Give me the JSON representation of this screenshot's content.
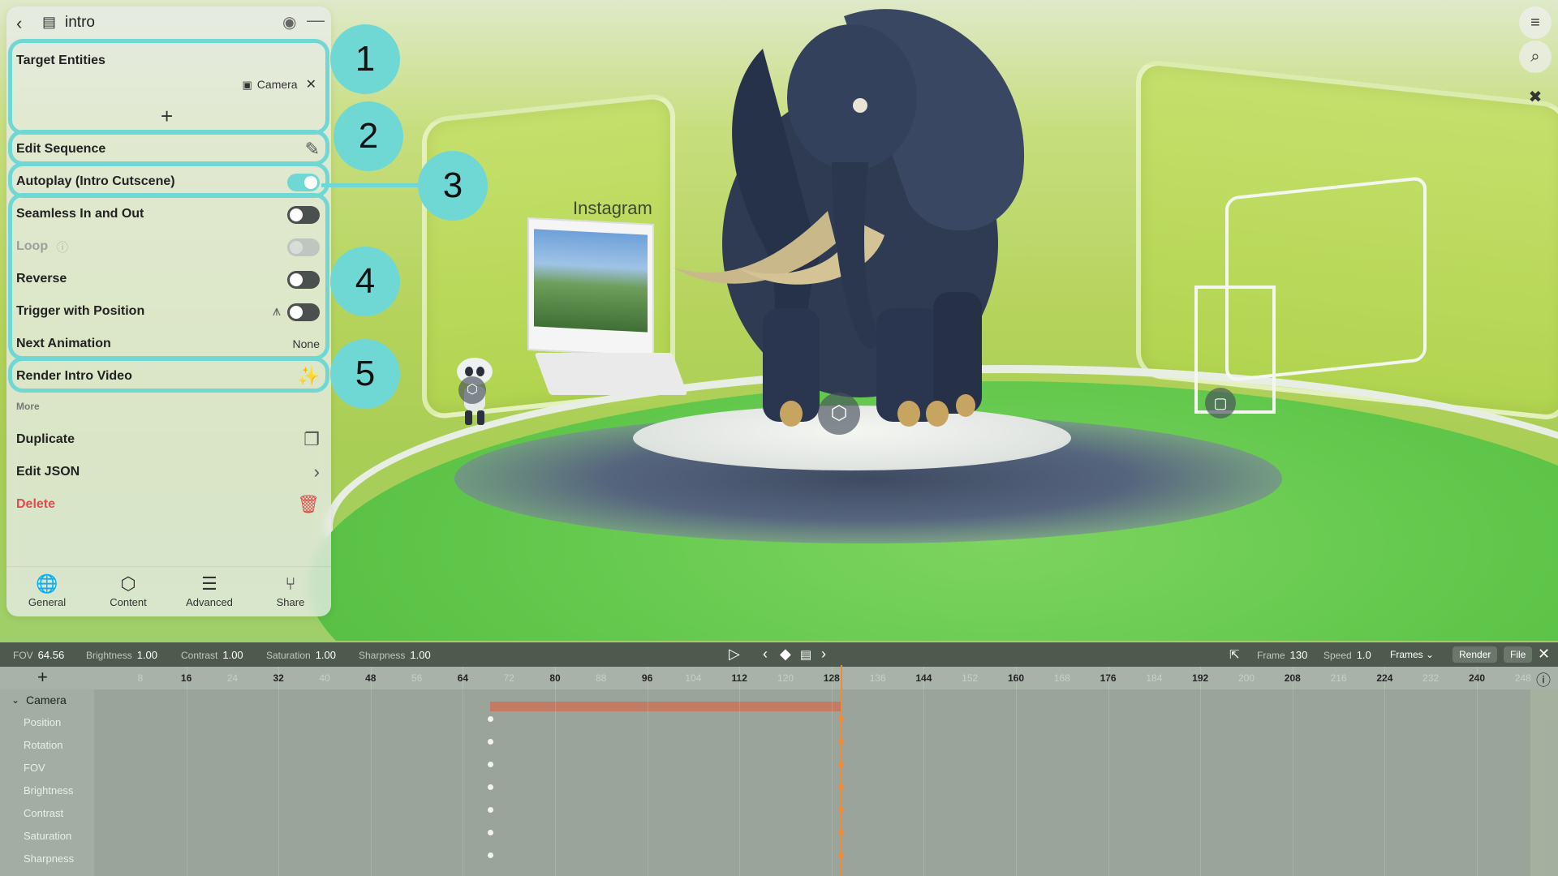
{
  "panel": {
    "title": "intro",
    "target_entities_label": "Target Entities",
    "target_chip_label": "Camera",
    "edit_sequence_label": "Edit Sequence",
    "autoplay_label": "Autoplay (Intro Cutscene)",
    "seamless_label": "Seamless In and Out",
    "loop_label": "Loop",
    "reverse_label": "Reverse",
    "trigger_label": "Trigger with Position",
    "next_animation_label": "Next Animation",
    "next_animation_value": "None",
    "render_video_label": "Render Intro Video",
    "more_label": "More",
    "duplicate_label": "Duplicate",
    "edit_json_label": "Edit JSON",
    "delete_label": "Delete",
    "toggles": {
      "autoplay": true,
      "seamless": false,
      "loop": false,
      "reverse": false,
      "trigger": false
    }
  },
  "tabs": [
    {
      "label": "General",
      "icon": "globe-icon"
    },
    {
      "label": "Content",
      "icon": "cube-plus-icon"
    },
    {
      "label": "Advanced",
      "icon": "menu-icon"
    },
    {
      "label": "Share",
      "icon": "share-icon"
    }
  ],
  "callouts": [
    "1",
    "2",
    "3",
    "4",
    "5"
  ],
  "scene": {
    "instagram_label": "Instagram"
  },
  "timeline": {
    "stats": [
      {
        "label": "FOV",
        "value": "64.56"
      },
      {
        "label": "Brightness",
        "value": "1.00"
      },
      {
        "label": "Contrast",
        "value": "1.00"
      },
      {
        "label": "Saturation",
        "value": "1.00"
      },
      {
        "label": "Sharpness",
        "value": "1.00"
      }
    ],
    "frame_label": "Frame",
    "frame_value": "130",
    "speed_label": "Speed",
    "speed_value": "1.0",
    "unit_select": "Frames",
    "render_btn": "Render",
    "file_btn": "File",
    "ruler_major": [
      "16",
      "32",
      "48",
      "64",
      "80",
      "96",
      "112",
      "128",
      "144",
      "160",
      "176",
      "192",
      "208",
      "224",
      "240"
    ],
    "ruler_minor": [
      "8",
      "24",
      "40",
      "56",
      "72",
      "88",
      "104",
      "120",
      "136",
      "152",
      "168",
      "184",
      "200",
      "216",
      "232",
      "248"
    ],
    "track_group": "Camera",
    "tracks": [
      "Position",
      "Rotation",
      "FOV",
      "Brightness",
      "Contrast",
      "Saturation",
      "Sharpness"
    ]
  },
  "colors": {
    "accent": "#6fd8d4",
    "danger": "#e04b4b",
    "keyframe": "#f08a3c"
  }
}
